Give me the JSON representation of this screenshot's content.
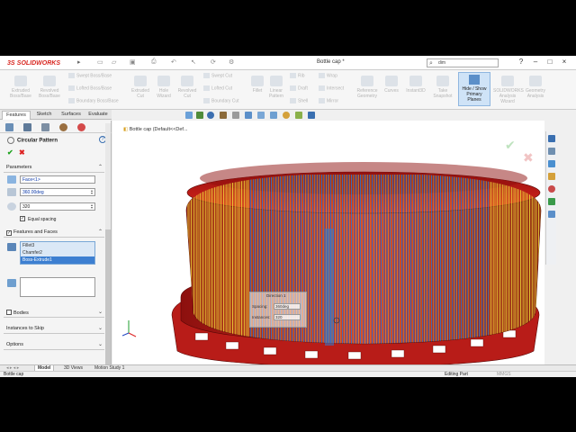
{
  "app": {
    "brand_prefix": "3S",
    "brand_name": "SOLIDWORKS",
    "document_title": "Bottle cap *",
    "search_value": "dim",
    "window_buttons": [
      "?",
      "–",
      "□",
      "×"
    ]
  },
  "ribbon": {
    "large_buttons": [
      {
        "label": "Extruded\nBoss/Base"
      },
      {
        "label": "Revolved\nBoss/Base"
      },
      {
        "label": "Extruded\nCut"
      },
      {
        "label": "Hole\nWizard"
      },
      {
        "label": "Revolved\nCut"
      },
      {
        "label": "Fillet"
      },
      {
        "label": "Linear\nPattern"
      },
      {
        "label": "Reference\nGeometry"
      },
      {
        "label": "Curves"
      },
      {
        "label": "Instant3D"
      },
      {
        "label": "Take\nSnapshot"
      },
      {
        "label": "SOLIDWORKS\nAnalysis\nWizard"
      },
      {
        "label": "Geometry\nAnalysis"
      }
    ],
    "small_buttons": [
      {
        "label": "Swept Boss/Base"
      },
      {
        "label": "Lofted Boss/Base"
      },
      {
        "label": "Boundary Boss/Base"
      },
      {
        "label": "Swept Cut"
      },
      {
        "label": "Lofted Cut"
      },
      {
        "label": "Boundary Cut"
      },
      {
        "label": "Rib"
      },
      {
        "label": "Draft"
      },
      {
        "label": "Shell"
      },
      {
        "label": "Wrap"
      },
      {
        "label": "Intersect"
      },
      {
        "label": "Mirror"
      }
    ],
    "active_button": {
      "label": "Hide / Show\nPrimary\nPlanes"
    }
  },
  "tabs": [
    "Features",
    "Sketch",
    "Surfaces",
    "Evaluate"
  ],
  "property_manager": {
    "title": "Circular Pattern",
    "ok_icon": "✔",
    "cancel_icon": "✖",
    "parameters_label": "Parameters",
    "axis_value": "Face<1>",
    "angle_value": "360.00deg",
    "instances_value": "320",
    "equal_spacing_label": "Equal spacing",
    "features_faces_label": "Features and Faces",
    "features_list": [
      "Fillet3",
      "Chamfer2",
      "Boss-Extrude1"
    ],
    "selected_feature_index": 2,
    "bodies_label": "Bodies",
    "instances_to_skip_label": "Instances to Skip",
    "options_label": "Options"
  },
  "viewport": {
    "breadcrumb": "Bottle cap  (Default<<Def...",
    "callout": {
      "title": "Direction 1",
      "spacing_label": "Spacing:",
      "spacing_value": "360deg",
      "instances_label": "Instances:",
      "instances_value": "320"
    },
    "colors": {
      "cap_red": "#c8201c",
      "knurl_yellow": "#f4e23a",
      "knurl_blue": "#2a7fd6"
    }
  },
  "bottom_tabs": [
    "Model",
    "3D Views",
    "Motion Study 1"
  ],
  "active_bottom_tab": 0,
  "status": {
    "left": "Bottle cap",
    "mode": "Editing Part",
    "units": "MMGS"
  }
}
